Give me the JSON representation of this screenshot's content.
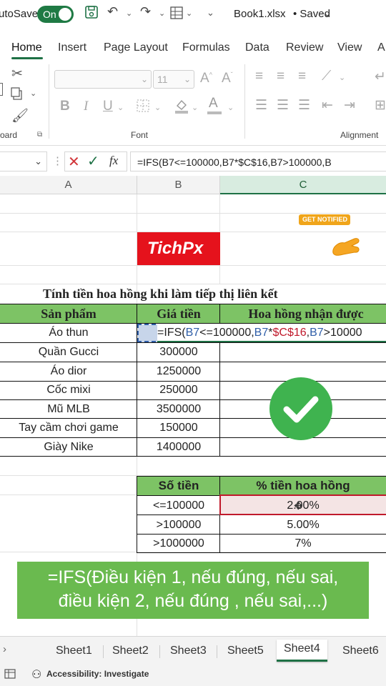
{
  "titlebar": {
    "autosave_label": "utoSave",
    "autosave_state": "On",
    "filename": "Book1.xlsx",
    "saved_status": "• Saved"
  },
  "tabs": [
    "Home",
    "Insert",
    "Page Layout",
    "Formulas",
    "Data",
    "Review",
    "View",
    "A"
  ],
  "ribbon": {
    "font_size": "11",
    "groups": {
      "clipboard": "oard",
      "font": "Font",
      "alignment": "Alignment"
    },
    "bold": "B",
    "italic": "I",
    "underline": "U"
  },
  "formula_bar": {
    "fx": "fx",
    "formula": "=IFS(B7<=100000,B7*$C$16,B7>100000,B"
  },
  "columns": [
    "A",
    "B",
    "C"
  ],
  "overlay": {
    "brand": "TichPx",
    "notify": "GET NOTIFIED"
  },
  "sheet": {
    "title": "Tính tiền hoa hồng khi làm tiếp thị liên kết",
    "headers": [
      "Sản phẩm",
      "Giá tiền",
      "Hoa hồng nhận được"
    ],
    "products": [
      {
        "name": "Áo thun",
        "price": ""
      },
      {
        "name": "Quần Gucci",
        "price": "300000"
      },
      {
        "name": "Áo dior",
        "price": "1250000"
      },
      {
        "name": "Cốc mixi",
        "price": "250000"
      },
      {
        "name": "Mũ MLB",
        "price": "3500000"
      },
      {
        "name": "Tay cầm chơi game",
        "price": "150000"
      },
      {
        "name": "Giày Nike",
        "price": "1400000"
      }
    ],
    "editing_formula": {
      "prefix": "=IFS(",
      "ref1": "B7",
      "mid1": "<=100000,",
      "ref2": "B7",
      "star": "*",
      "ref3": "$C$16",
      "comma": ",",
      "ref4": "B7",
      "tail": ">10000"
    },
    "rate_headers": [
      "Số tiền",
      "% tiền hoa hồng"
    ],
    "rates": [
      {
        "amount": "<=100000",
        "rate": "2.00%"
      },
      {
        "amount": ">100000",
        "rate": "5.00%"
      },
      {
        "amount": ">1000000",
        "rate": "7%"
      }
    ]
  },
  "caption": {
    "line1": "=IFS(Điều kiện 1, nếu đúng, nếu sai,",
    "line2": "điều kiện 2, nếu đúng , nếu sai,...)"
  },
  "sheet_tabs": [
    "Sheet1",
    "Sheet2",
    "Sheet3",
    "Sheet5",
    "Sheet4",
    "Sheet6"
  ],
  "status": {
    "accessibility": "Accessibility: Investigate"
  },
  "colors": {
    "excel_green": "#1e7145",
    "header_green": "#7dc365",
    "caption_green": "#6aba4f",
    "brand_red": "#e5121c"
  }
}
